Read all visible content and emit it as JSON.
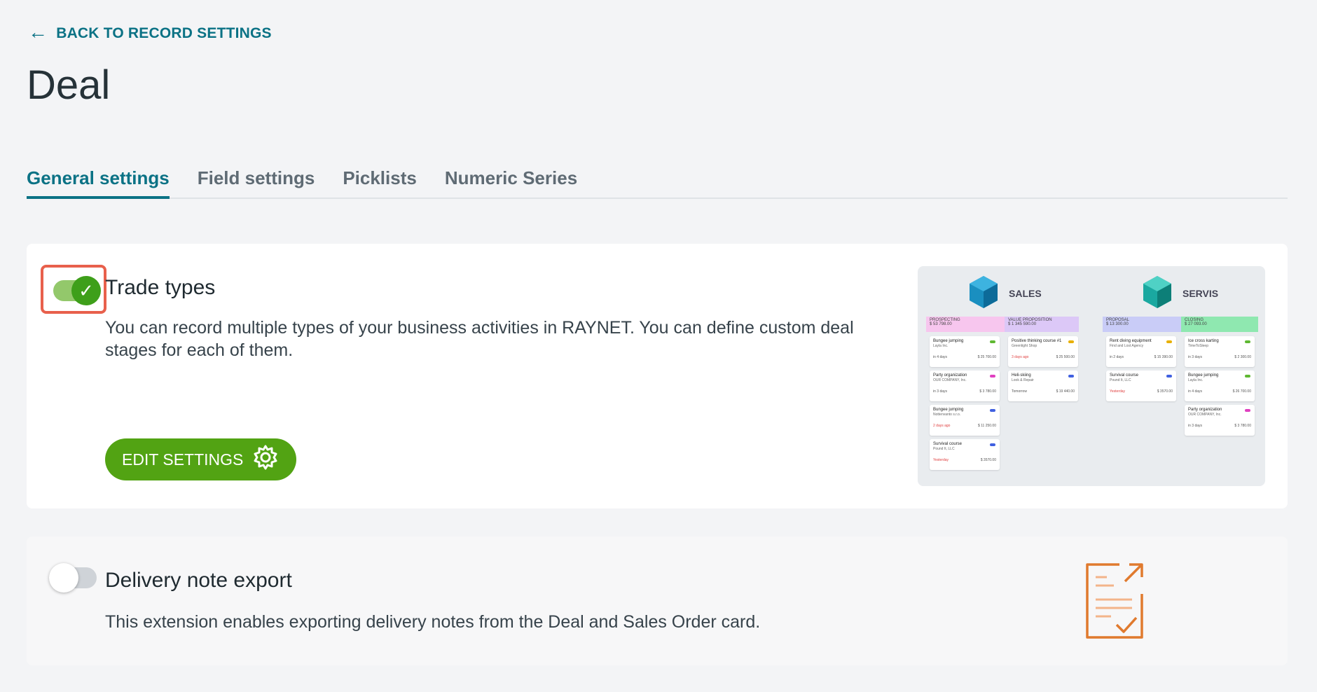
{
  "back_link": {
    "arrow": "←",
    "label": "BACK TO RECORD SETTINGS"
  },
  "page_title": "Deal",
  "tabs": [
    {
      "label": "General settings",
      "active": true
    },
    {
      "label": "Field settings",
      "active": false
    },
    {
      "label": "Picklists",
      "active": false
    },
    {
      "label": "Numeric Series",
      "active": false
    }
  ],
  "cards": [
    {
      "title": "Trade types",
      "enabled": true,
      "description": "You can record multiple types of your business activities in RAYNET. You can define custom deal stages for each of them.",
      "button_label": "EDIT SETTINGS",
      "preview": {
        "pipelines": [
          {
            "name": "SALES",
            "stages": [
              {
                "name": "PROSPECTING",
                "value": "$ 53 798.00",
                "color": "#f7c6ee"
              },
              {
                "name": "VALUE PROPOSITION",
                "value": "$ 1 345 590.00",
                "color": "#dcc8f7"
              }
            ],
            "cards": [
              {
                "title": "Bungee jumping",
                "company": "Layla Inc.",
                "when": "in 4 days",
                "value": "$ 25 700.00",
                "tag": "#5fb832"
              },
              {
                "title": "Party organization",
                "company": "OUR COMPANY, Inc.",
                "when": "in 3 days",
                "value": "$ 3 780.00",
                "tag": "#e040c0"
              },
              {
                "title": "Bungee jumping",
                "company": "Nottenvanto s.r.o.",
                "when": "2 days ago",
                "value": "$ 11 250.00",
                "tag": "#4060e0"
              },
              {
                "title": "Survival course",
                "company": "Pound It, LLC",
                "when": "Yesterday",
                "value": "$ 3570.00",
                "tag": "#4060e0"
              },
              {
                "title": "Positive thinking course #1",
                "company": "Greenlight Shop",
                "when": "3 days ago",
                "value": "$ 25 500.00",
                "tag": "#e8b000"
              },
              {
                "title": "Heli-skiing",
                "company": "Look & Repair",
                "when": "Tomorrow",
                "value": "$ 19 440.00",
                "tag": "#4060e0"
              }
            ]
          },
          {
            "name": "SERVIS",
            "stages": [
              {
                "name": "PROPOSAL",
                "value": "$ 13 300.00",
                "color": "#c9ccf7"
              },
              {
                "name": "CLOSING",
                "value": "$ 27 093.00",
                "color": "#8fe8b0"
              }
            ],
            "cards": [
              {
                "title": "Rent diving equipment",
                "company": "Find and Lost Agency",
                "when": "in 2 days",
                "value": "$ 15 390.00",
                "tag": "#e8b000"
              },
              {
                "title": "Survival course",
                "company": "Pound It, LLC",
                "when": "Yesterday",
                "value": "$ 3570.00",
                "tag": "#4060e0"
              },
              {
                "title": "Ice cross karting",
                "company": "TimeToSleep",
                "when": "in 3 days",
                "value": "$ 2 300.00",
                "tag": "#5fb832"
              },
              {
                "title": "Bungee jumping",
                "company": "Layla Inc.",
                "when": "in 4 days",
                "value": "$ 26 700.00",
                "tag": "#5fb832"
              },
              {
                "title": "Party organization",
                "company": "OUR COMPANY, Inc.",
                "when": "in 3 days",
                "value": "$ 3 780.00",
                "tag": "#e040c0"
              }
            ]
          }
        ]
      }
    },
    {
      "title": "Delivery note export",
      "enabled": false,
      "description": "This extension enables exporting delivery notes from the Deal and Sales Order card."
    }
  ],
  "colors": {
    "accent": "#0b7285",
    "button_green": "#52a313",
    "toggle_on": "#3e9f1a",
    "highlight": "#e8604c",
    "doc_icon": "#e07a2e"
  }
}
